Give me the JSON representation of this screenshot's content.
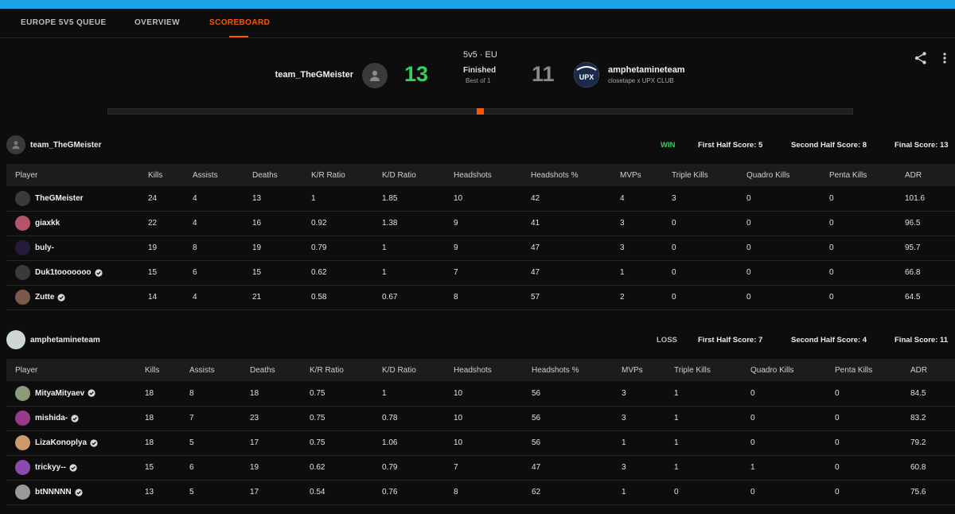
{
  "tabs": [
    "EUROPE 5V5 QUEUE",
    "OVERVIEW",
    "SCOREBOARD"
  ],
  "match": {
    "mode": "5v5 · EU",
    "status": "Finished",
    "best_of": "Best of 1",
    "team_left": "team_TheGMeister",
    "team_right": "amphetamineteam",
    "team_right_sub": "closetape x UPX CLUB",
    "team_right_logo_text": "UPX",
    "score_left": "13",
    "score_right": "11"
  },
  "colors": {
    "accent": "#ff5500",
    "win": "#32d35a",
    "topbar": "#1aa3e8"
  },
  "columns": [
    "Player",
    "Kills",
    "Assists",
    "Deaths",
    "K/R Ratio",
    "K/D Ratio",
    "Headshots",
    "Headshots %",
    "MVPs",
    "Triple Kills",
    "Quadro Kills",
    "Penta Kills",
    "ADR"
  ],
  "teams": [
    {
      "name": "team_TheGMeister",
      "result": "WIN",
      "first_half": "First Half Score: 5",
      "second_half": "Second Half Score: 8",
      "final": "Final Score: 13",
      "players": [
        {
          "name": "TheGMeister",
          "verified": false,
          "avatar": "#3a3a3a",
          "stats": [
            "24",
            "4",
            "13",
            "1",
            "1.85",
            "10",
            "42",
            "4",
            "3",
            "0",
            "0",
            "101.6"
          ]
        },
        {
          "name": "giaxkk",
          "verified": false,
          "avatar": "#b5536b",
          "stats": [
            "22",
            "4",
            "16",
            "0.92",
            "1.38",
            "9",
            "41",
            "3",
            "0",
            "0",
            "0",
            "96.5"
          ]
        },
        {
          "name": "buly-",
          "verified": false,
          "avatar": "#241b3a",
          "stats": [
            "19",
            "8",
            "19",
            "0.79",
            "1",
            "9",
            "47",
            "3",
            "0",
            "0",
            "0",
            "95.7"
          ]
        },
        {
          "name": "Duk1tooooooo",
          "verified": true,
          "avatar": "#3a3a3a",
          "stats": [
            "15",
            "6",
            "15",
            "0.62",
            "1",
            "7",
            "47",
            "1",
            "0",
            "0",
            "0",
            "66.8"
          ]
        },
        {
          "name": "Zutte",
          "verified": true,
          "avatar": "#7a5a4a",
          "stats": [
            "14",
            "4",
            "21",
            "0.58",
            "0.67",
            "8",
            "57",
            "2",
            "0",
            "0",
            "0",
            "64.5"
          ]
        }
      ]
    },
    {
      "name": "amphetamineteam",
      "result": "LOSS",
      "first_half": "First Half Score: 7",
      "second_half": "Second Half Score: 4",
      "final": "Final Score: 11",
      "players": [
        {
          "name": "MityaMityaev",
          "verified": true,
          "avatar": "#8a9a7a",
          "stats": [
            "18",
            "8",
            "18",
            "0.75",
            "1",
            "10",
            "56",
            "3",
            "1",
            "0",
            "0",
            "84.5"
          ]
        },
        {
          "name": "mishida-",
          "verified": true,
          "avatar": "#9a3a8a",
          "stats": [
            "18",
            "7",
            "23",
            "0.75",
            "0.78",
            "10",
            "56",
            "3",
            "1",
            "0",
            "0",
            "83.2"
          ]
        },
        {
          "name": "LizaKonoplya",
          "verified": true,
          "avatar": "#c99a6a",
          "stats": [
            "18",
            "5",
            "17",
            "0.75",
            "1.06",
            "10",
            "56",
            "1",
            "1",
            "0",
            "0",
            "79.2"
          ]
        },
        {
          "name": "trickyy--",
          "verified": true,
          "avatar": "#8a4ab0",
          "stats": [
            "15",
            "6",
            "19",
            "0.62",
            "0.79",
            "7",
            "47",
            "3",
            "1",
            "1",
            "0",
            "60.8"
          ]
        },
        {
          "name": "btNNNNN",
          "verified": true,
          "avatar": "#9a9a9a",
          "stats": [
            "13",
            "5",
            "17",
            "0.54",
            "0.76",
            "8",
            "62",
            "1",
            "0",
            "0",
            "0",
            "75.6"
          ]
        }
      ]
    }
  ]
}
